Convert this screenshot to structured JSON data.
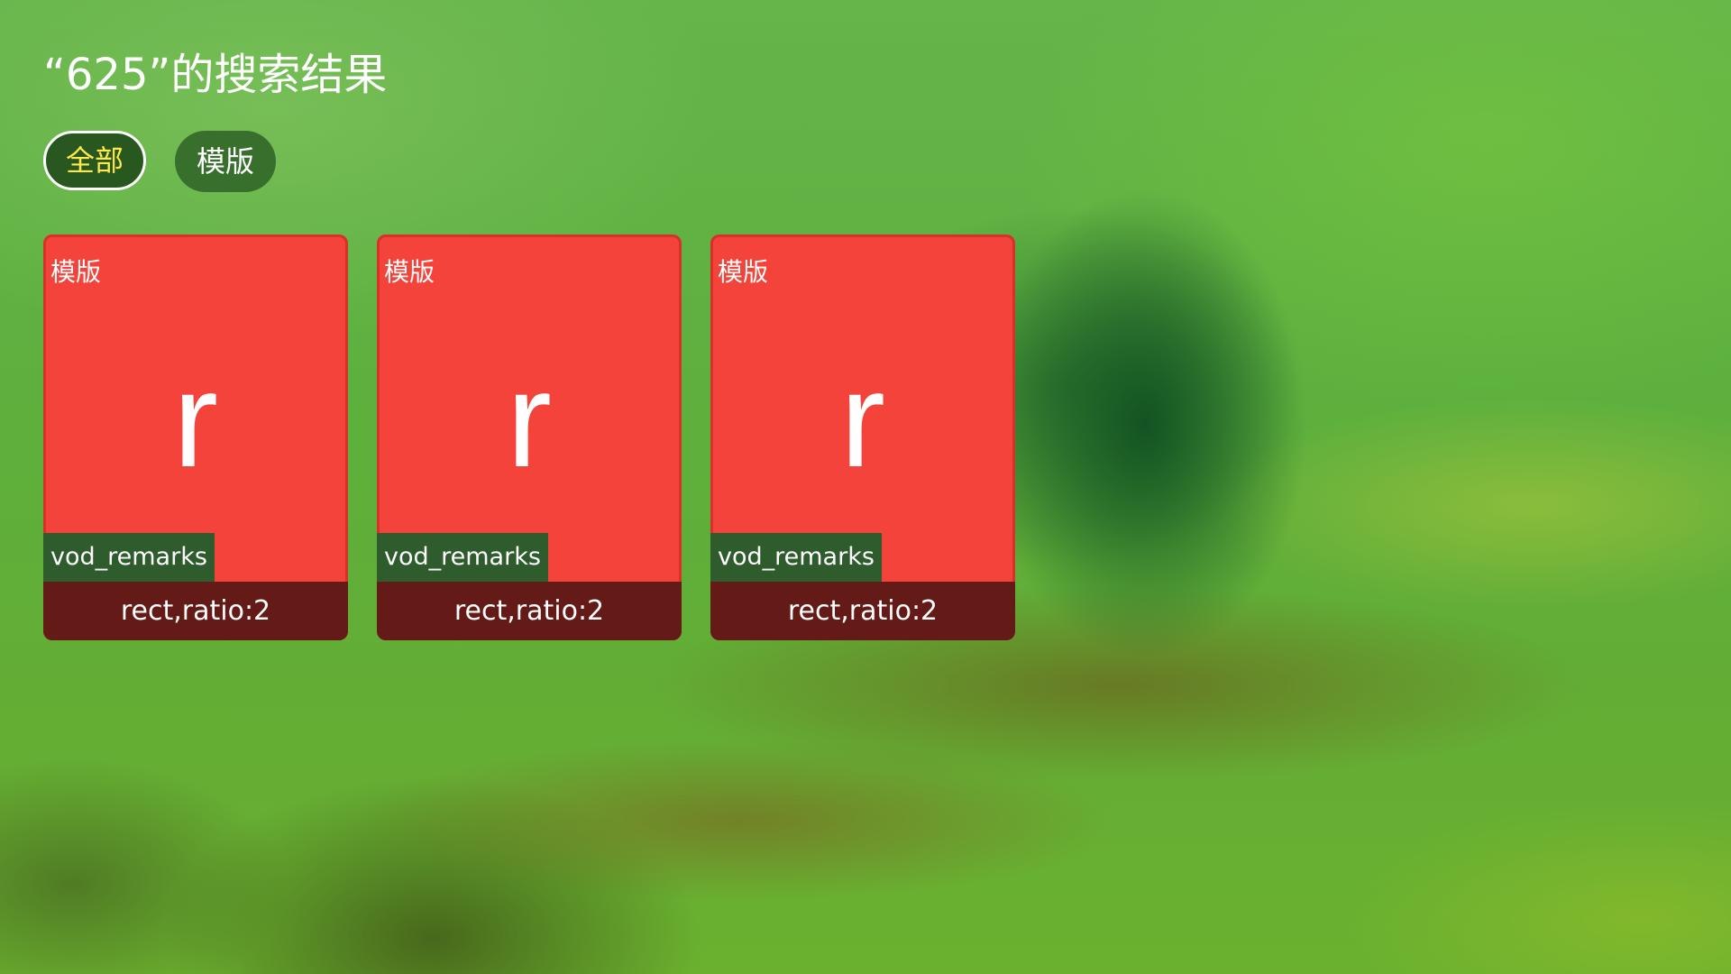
{
  "header": {
    "title": "“625”的搜索结果"
  },
  "tabs": [
    {
      "label": "全部",
      "active": true
    },
    {
      "label": "模版",
      "active": false
    }
  ],
  "results": [
    {
      "type_label": "模版",
      "poster_letter": "r",
      "remarks": "vod_remarks",
      "name": "rect,ratio:2"
    },
    {
      "type_label": "模版",
      "poster_letter": "r",
      "remarks": "vod_remarks",
      "name": "rect,ratio:2"
    },
    {
      "type_label": "模版",
      "poster_letter": "r",
      "remarks": "vod_remarks",
      "name": "rect,ratio:2"
    }
  ],
  "colors": {
    "card_background": "#f4433a",
    "card_footer": "#641a17",
    "remarks_badge": "#2f5c2c",
    "active_tab_text": "#ffe94a",
    "tab_background": "#285a23"
  }
}
